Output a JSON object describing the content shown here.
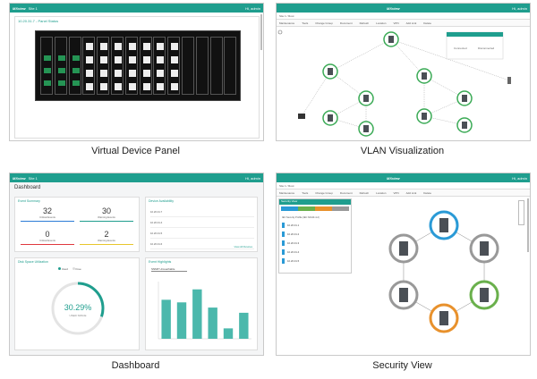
{
  "captions": {
    "panel1": "Virtual Device Panel",
    "panel2": "VLAN Visualization",
    "panel3": "Dashboard",
    "panel4": "Security View"
  },
  "app": {
    "logo": "MXview",
    "user": "Hi, admin"
  },
  "panel1": {
    "site": "Site 1",
    "title": "10.20.31.7 - Panel Status"
  },
  "panel2": {
    "breadcrumb": "Site 1 / Root",
    "toolbar": [
      "Maintenance",
      "Tools",
      "Change Group",
      "Document",
      "Refresh",
      "Location",
      "VPN",
      "Add Link",
      "Delete"
    ],
    "popup_options": [
      "Connected",
      "Disconnected"
    ]
  },
  "panel3": {
    "site": "Site 1",
    "page_title": "Dashboard",
    "event_summary": {
      "title": "Event Summary",
      "counts": [
        {
          "value": "32",
          "label": "Critical Events",
          "color": "#2a7bd6"
        },
        {
          "value": "30",
          "label": "Warning Events",
          "color": "#1f9e8e"
        },
        {
          "value": "0",
          "label": "Critical Events",
          "color": "#e0393e"
        },
        {
          "value": "2",
          "label": "Warning Events",
          "color": "#e8c62c"
        }
      ]
    },
    "device_availability": {
      "title": "Device Availability",
      "rows": [
        "10.20.31.7",
        "10.20.31.4",
        "10.20.31.5",
        "10.20.31.6"
      ],
      "link": "View All Devices"
    },
    "disk": {
      "title": "Disk Space Utilization",
      "legend": [
        "Used",
        "Free"
      ],
      "percent": "30.29%",
      "sub": "USED SPACE"
    },
    "event_highlights": {
      "title": "Event Highlights",
      "select": "SNMP Unreachable"
    }
  },
  "panel4": {
    "breadcrumb": "Site 1 / Root",
    "toolbar": [
      "Maintenance",
      "Tools",
      "Change Group",
      "Document",
      "Refresh",
      "Location",
      "VPN",
      "Add Link",
      "Delete"
    ],
    "security_list_title": "Security View",
    "list_header": "IEC Security Profile (IEC 62443-4-2)",
    "list_items": [
      "10.20.31.1",
      "10.20.31.2",
      "10.20.31.3",
      "10.20.31.4",
      "10.20.31.5"
    ]
  },
  "chart_data": {
    "type": "bar",
    "title": "Event Highlights",
    "categories": [
      "",
      "",
      "",
      "",
      "",
      ""
    ],
    "values": [
      15,
      14,
      19,
      12,
      4,
      10
    ],
    "ylim": [
      0,
      22
    ],
    "color": "#4bb8ac"
  }
}
